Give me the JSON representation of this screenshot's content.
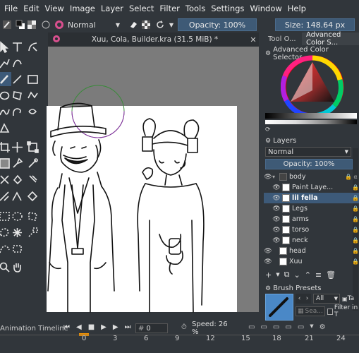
{
  "menu": [
    "File",
    "Edit",
    "View",
    "Image",
    "Layer",
    "Select",
    "Filter",
    "Tools",
    "Settings",
    "Window",
    "Help"
  ],
  "toolbar": {
    "blend_mode": "Normal",
    "opacity": "Opacity: 100%",
    "size": "Size: 148.64 px"
  },
  "document": {
    "tab_title": "Xuu, Cola, Builder.kra (31.5 MiB) *"
  },
  "dock": {
    "tabs": [
      "Tool O...",
      "Advanced Color S..."
    ],
    "color_selector_title": "Advanced Color Selector",
    "layers_title": "Layers",
    "layers_blend": "Normal",
    "layers_opacity": "Opacity:  100%",
    "layers": [
      {
        "name": "body"
      },
      {
        "name": "Paint Laye..."
      },
      {
        "name": "lil fella"
      },
      {
        "name": "Legs"
      },
      {
        "name": "arms"
      },
      {
        "name": "torso"
      },
      {
        "name": "neck"
      },
      {
        "name": "head"
      },
      {
        "name": "Xuu"
      }
    ],
    "brush_presets_title": "Brush Presets",
    "brush_filter": "All",
    "brush_tag": "Ta",
    "search_placeholder": "Sea...",
    "filter_in_tag": "Filter in T"
  },
  "timeline": {
    "title": "Animation Timeline",
    "frame": "0",
    "speed": "Speed: 26 %",
    "ruler": [
      "0",
      "3",
      "6",
      "9",
      "12",
      "15",
      "18",
      "21",
      "24"
    ]
  },
  "colors": {
    "accent": "#3d5a79",
    "bg": "#31363b",
    "paper": "#ffffff",
    "canvas_bg": "#7b7b7b"
  }
}
